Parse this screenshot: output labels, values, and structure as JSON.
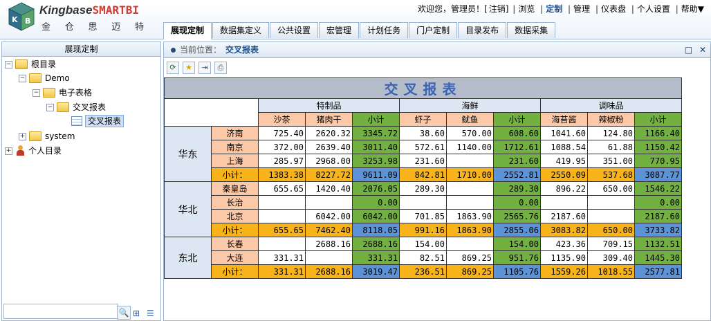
{
  "app": {
    "brand_main": "Kingbase",
    "brand_accent": "SMART",
    "brand_suffix": "BI",
    "brand_cn": [
      "金",
      "仓",
      "思",
      "迈",
      "特"
    ],
    "logo_letters": [
      "K",
      "B"
    ]
  },
  "topnav": {
    "welcome": "欢迎您，管理员！[",
    "logout": "注销",
    "welcome_end": "]",
    "items": [
      "浏览",
      "定制",
      "管理",
      "仪表盘",
      "个人设置",
      "帮助▼"
    ]
  },
  "tabs": [
    "展现定制",
    "数据集定义",
    "公共设置",
    "宏管理",
    "计划任务",
    "门户定制",
    "目录发布",
    "数据采集"
  ],
  "left": {
    "title": "展现定制",
    "tree": [
      {
        "label": "根目录",
        "exp": "−"
      },
      {
        "label": "Demo",
        "exp": "−"
      },
      {
        "label": "电子表格",
        "exp": "−"
      },
      {
        "label": "交叉报表",
        "exp": "−"
      },
      {
        "label": "交叉报表"
      },
      {
        "label": "system",
        "exp": "+"
      },
      {
        "label": "个人目录",
        "exp": "+"
      }
    ],
    "search_value": ""
  },
  "right": {
    "crumb_label": "当前位置：",
    "crumb_current": "交叉报表",
    "win_max": "□",
    "win_close": "✕"
  },
  "toolbar_icons": [
    "refresh-icon",
    "favorite-icon",
    "export-icon",
    "print-icon"
  ],
  "colors": {
    "title_bg": "#b4bdc9",
    "group_header": "#dde7f3",
    "peach": "#fcc9a8",
    "green": "#72b042",
    "orange": "#f8b31a",
    "blue": "#5b93d6"
  },
  "report": {
    "title": "交叉报表",
    "groups": [
      "特制品",
      "海鲜",
      "调味品"
    ],
    "columns": [
      "沙茶",
      "猪肉干",
      "小计",
      "虾子",
      "鱿鱼",
      "小计",
      "海苔酱",
      "辣椒粉",
      "小计"
    ],
    "subtotal_label": "小计：",
    "regions": [
      {
        "name": "华东",
        "rows": [
          {
            "city": "济南",
            "v": [
              "725.40",
              "2620.32",
              "3345.72",
              "38.60",
              "570.00",
              "608.60",
              "1041.60",
              "124.80",
              "1166.40"
            ]
          },
          {
            "city": "南京",
            "v": [
              "372.00",
              "2639.40",
              "3011.40",
              "572.61",
              "1140.00",
              "1712.61",
              "1088.54",
              "61.88",
              "1150.42"
            ]
          },
          {
            "city": "上海",
            "v": [
              "285.97",
              "2968.00",
              "3253.98",
              "231.60",
              "",
              "231.60",
              "419.95",
              "351.00",
              "770.95"
            ]
          }
        ],
        "subtotal": [
          "1383.38",
          "8227.72",
          "9611.09",
          "842.81",
          "1710.00",
          "2552.81",
          "2550.09",
          "537.68",
          "3087.77"
        ]
      },
      {
        "name": "华北",
        "rows": [
          {
            "city": "秦皇岛",
            "v": [
              "655.65",
              "1420.40",
              "2076.05",
              "289.30",
              "",
              "289.30",
              "896.22",
              "650.00",
              "1546.22"
            ]
          },
          {
            "city": "长治",
            "v": [
              "",
              "",
              "0.00",
              "",
              "",
              "0.00",
              "",
              "",
              "0.00"
            ]
          },
          {
            "city": "北京",
            "v": [
              "",
              "6042.00",
              "6042.00",
              "701.85",
              "1863.90",
              "2565.76",
              "2187.60",
              "",
              "2187.60"
            ]
          }
        ],
        "subtotal": [
          "655.65",
          "7462.40",
          "8118.05",
          "991.16",
          "1863.90",
          "2855.06",
          "3083.82",
          "650.00",
          "3733.82"
        ]
      },
      {
        "name": "东北",
        "rows": [
          {
            "city": "长春",
            "v": [
              "",
              "2688.16",
              "2688.16",
              "154.00",
              "",
              "154.00",
              "423.36",
              "709.15",
              "1132.51"
            ]
          },
          {
            "city": "大连",
            "v": [
              "331.31",
              "",
              "331.31",
              "82.51",
              "869.25",
              "951.76",
              "1135.90",
              "309.40",
              "1445.30"
            ]
          }
        ],
        "subtotal": [
          "331.31",
          "2688.16",
          "3019.47",
          "236.51",
          "869.25",
          "1105.76",
          "1559.26",
          "1018.55",
          "2577.81"
        ]
      }
    ]
  }
}
